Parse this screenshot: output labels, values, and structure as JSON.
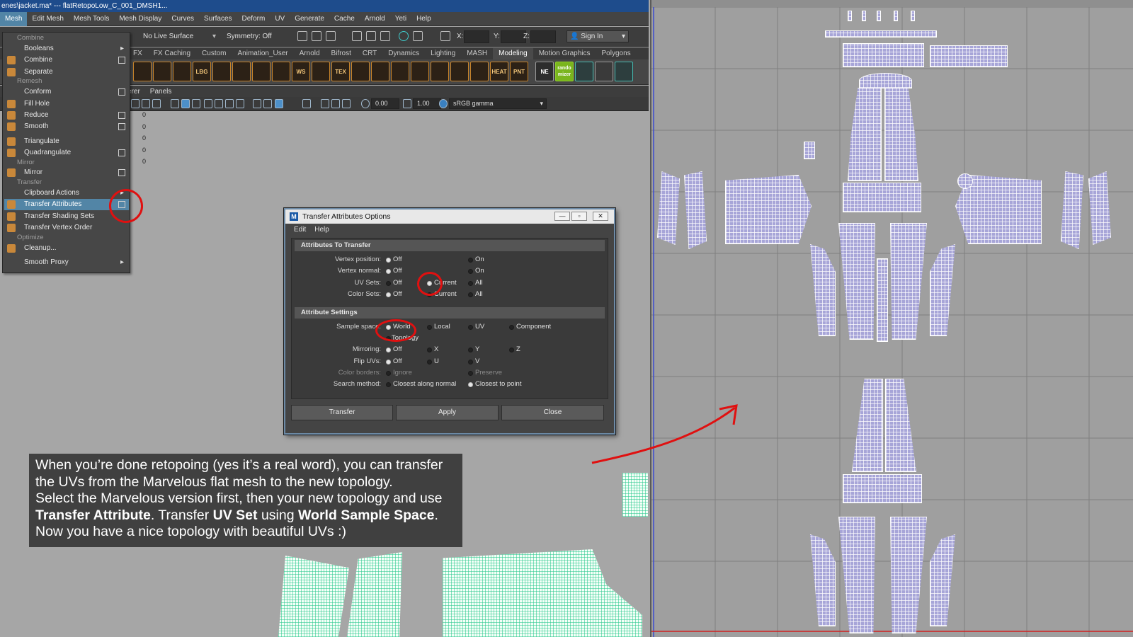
{
  "window": {
    "title": "enes\\jacket.ma*  ---  flatRetopoLow_C_001_DMSH1..."
  },
  "menubar": [
    "Mesh",
    "Edit Mesh",
    "Mesh Tools",
    "Mesh Display",
    "Curves",
    "Surfaces",
    "Deform",
    "UV",
    "Generate",
    "Cache",
    "Arnold",
    "Yeti",
    "Help"
  ],
  "statusline": {
    "live_surface": "No Live Surface",
    "symmetry": "Symmetry: Off",
    "x_label": "X:",
    "y_label": "Y:",
    "z_label": "Z:",
    "sign_in": "Sign In"
  },
  "shelf_tabs": [
    "FX",
    "FX Caching",
    "Custom",
    "Animation_User",
    "Arnold",
    "Bifrost",
    "CRT",
    "Dynamics",
    "Lighting",
    "MASH",
    "Modeling",
    "Motion Graphics",
    "Polygons"
  ],
  "shelf_icons": [
    "LBG",
    "WS",
    "TEX",
    "HEAT",
    "PNT",
    "NE",
    "rando mizer"
  ],
  "panel_menu": [
    "erer",
    "Panels"
  ],
  "viewport_toolbar": {
    "exposure": "0.00",
    "gamma": "1.00",
    "view_transform": "sRGB gamma"
  },
  "channel_values": [
    "0",
    "0",
    "0",
    "0",
    "0"
  ],
  "mesh_menu": {
    "h_combine": "Combine",
    "booleans": "Booleans",
    "combine": "Combine",
    "separate": "Separate",
    "h_remesh": "Remesh",
    "conform": "Conform",
    "fill_hole": "Fill Hole",
    "reduce": "Reduce",
    "smooth": "Smooth",
    "triangulate": "Triangulate",
    "quadrangulate": "Quadrangulate",
    "h_mirror": "Mirror",
    "mirror": "Mirror",
    "h_transfer": "Transfer",
    "clipboard_actions": "Clipboard Actions",
    "transfer_attributes": "Transfer Attributes",
    "transfer_shading_sets": "Transfer Shading Sets",
    "transfer_vertex_order": "Transfer Vertex Order",
    "h_optimize": "Optimize",
    "cleanup": "Cleanup...",
    "smooth_proxy": "Smooth Proxy"
  },
  "dialog": {
    "logo": "M",
    "title": "Transfer Attributes Options",
    "menu": [
      "Edit",
      "Help"
    ],
    "section1": "Attributes To Transfer",
    "vertex_position": {
      "label": "Vertex position:",
      "off": "Off",
      "on": "On"
    },
    "vertex_normal": {
      "label": "Vertex normal:",
      "off": "Off",
      "on": "On"
    },
    "uv_sets": {
      "label": "UV Sets:",
      "off": "Off",
      "current": "Current",
      "all": "All"
    },
    "color_sets": {
      "label": "Color Sets:",
      "off": "Off",
      "current": "Current",
      "all": "All"
    },
    "section2": "Attribute Settings",
    "sample_space": {
      "label": "Sample space:",
      "world": "World",
      "local": "Local",
      "uv": "UV",
      "component": "Component",
      "topology": "Topology"
    },
    "mirroring": {
      "label": "Mirroring:",
      "off": "Off",
      "x": "X",
      "y": "Y",
      "z": "Z"
    },
    "flip_uvs": {
      "label": "Flip UVs:",
      "off": "Off",
      "u": "U",
      "v": "V"
    },
    "color_borders": {
      "label": "Color borders:",
      "ignore": "Ignore",
      "preserve": "Preserve"
    },
    "search_method": {
      "label": "Search method:",
      "closest_along_normal": "Closest along normal",
      "closest_to_point": "Closest to point"
    },
    "buttons": {
      "transfer": "Transfer",
      "apply": "Apply",
      "close": "Close"
    }
  },
  "caption": {
    "line1": "When you’re done retopoing (yes it’s a real word), you can transfer",
    "line2": "the UVs from the Marvelous flat mesh to the new topology.",
    "line3": "Select the Marvelous version first, then your new topology and use",
    "line4_bold1": "Transfer Attribute",
    "line4_t1": ". Transfer ",
    "line4_bold2": "UV Set",
    "line4_t2": " using ",
    "line4_bold3": "World Sample Space",
    "line4_t3": ".",
    "line5": "Now you have a nice topology with beautiful UVs :)"
  }
}
